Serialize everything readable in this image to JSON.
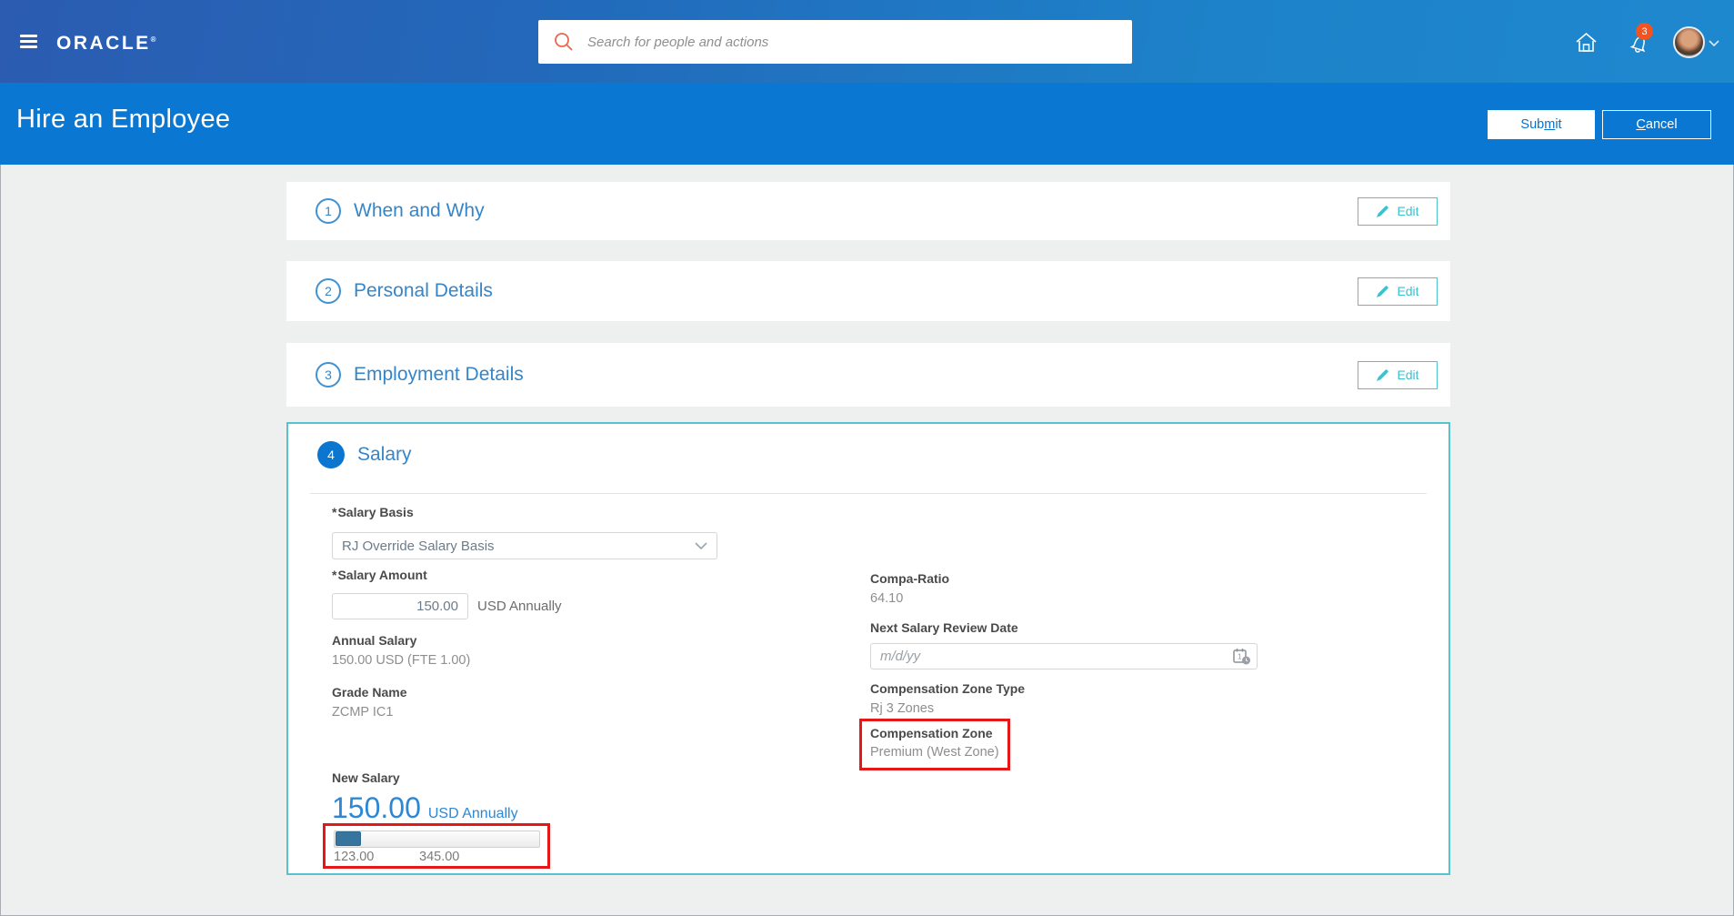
{
  "topbar": {
    "brand": "ORACLE",
    "brand_mark": "®",
    "search_placeholder": "Search for people and actions",
    "notification_count": "3"
  },
  "banner": {
    "title": "Hire an Employee",
    "submit": {
      "pre": "Sub",
      "key": "m",
      "post": "it"
    },
    "cancel": {
      "key": "C",
      "post": "ancel"
    }
  },
  "sections": [
    {
      "number": "1",
      "title": "When and Why",
      "edit_label": "Edit"
    },
    {
      "number": "2",
      "title": "Personal Details",
      "edit_label": "Edit"
    },
    {
      "number": "3",
      "title": "Employment Details",
      "edit_label": "Edit"
    }
  ],
  "salary": {
    "number": "4",
    "title": "Salary",
    "required_marker": "*",
    "salary_basis_label": "Salary Basis",
    "salary_basis_value": "RJ Override Salary Basis",
    "salary_amount_label": "Salary Amount",
    "salary_amount_value": "150.00",
    "salary_amount_suffix": "USD Annually",
    "annual_salary_label": "Annual Salary",
    "annual_salary_value": "150.00 USD (FTE 1.00)",
    "grade_name_label": "Grade Name",
    "grade_name_value": "ZCMP IC1",
    "compa_ratio_label": "Compa-Ratio",
    "compa_ratio_value": "64.10",
    "review_date_label": "Next Salary Review Date",
    "review_date_placeholder": "m/d/yy",
    "zone_type_label": "Compensation Zone Type",
    "zone_type_value": "Rj 3 Zones",
    "zone_label": "Compensation Zone",
    "zone_value": "Premium (West Zone)",
    "new_salary_label": "New Salary",
    "new_salary_value": "150.00",
    "new_salary_suffix": "USD Annually",
    "range_min": "123.00",
    "range_max": "345.00"
  },
  "colors": {
    "banner_blue": "#0a78d2",
    "topbar_gradient_start": "#2b5cb1",
    "topbar_gradient_end": "#1e88cf",
    "section_title_blue": "#3585c8",
    "step_filled_blue": "#0b76d0",
    "edit_teal": "#4fc2cf",
    "active_card_border_teal": "#57c3cf",
    "annotation_red": "#e51717",
    "badge_orange": "#f05423",
    "search_icon_orange": "#e9674a",
    "slider_handle_blue": "#35759e",
    "big_value_blue": "#2e87d4"
  }
}
